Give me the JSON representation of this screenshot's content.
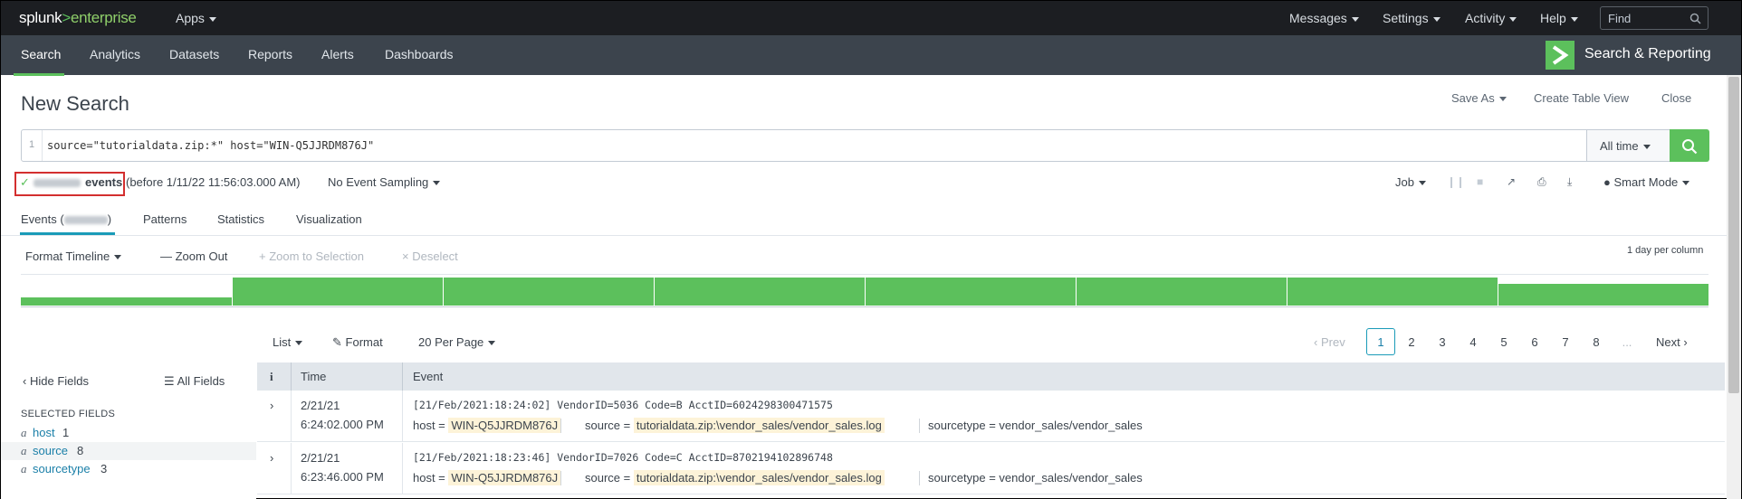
{
  "topbar": {
    "logo_splunk": "splunk",
    "logo_gt": ">",
    "logo_enterprise": "enterprise",
    "apps_label": "Apps",
    "menu": [
      "Messages",
      "Settings",
      "Activity",
      "Help"
    ],
    "find_placeholder": "Find"
  },
  "appbar": {
    "nav": [
      "Search",
      "Analytics",
      "Datasets",
      "Reports",
      "Alerts",
      "Dashboards"
    ],
    "active_nav": "Search",
    "app_title": "Search & Reporting",
    "accent_color": "#5cc05c"
  },
  "page": {
    "title": "New Search",
    "actions": {
      "save_as": "Save As",
      "create_table_view": "Create Table View",
      "close": "Close"
    }
  },
  "search": {
    "line_number": "1",
    "query": "source=\"tutorialdata.zip:*\" host=\"WIN-Q5JJRDM876J\"",
    "time_range": "All time"
  },
  "status": {
    "check": "✓",
    "events_label": "events",
    "before_text": "(before 1/11/22 11:56:03.000 AM)",
    "event_sampling": "No Event Sampling",
    "job_label": "Job",
    "mode": "Smart Mode",
    "highlight_color": "#d32f2f"
  },
  "tabs": {
    "events": "Events (",
    "events_close": ")",
    "patterns": "Patterns",
    "statistics": "Statistics",
    "visualization": "Visualization"
  },
  "timeline": {
    "format_timeline": "Format Timeline",
    "zoom_out": "— Zoom Out",
    "zoom_to_selection": "+ Zoom to Selection",
    "deselect": "× Deselect",
    "scale_note": "1 day per column",
    "column_levels": [
      0.25,
      0.9,
      0.9,
      0.9,
      0.9,
      0.9,
      0.9,
      0.7
    ]
  },
  "results_controls": {
    "list": "List",
    "format": "Format",
    "per_page": "20 Per Page",
    "prev": "Prev",
    "pages": [
      "1",
      "2",
      "3",
      "4",
      "5",
      "6",
      "7",
      "8"
    ],
    "ellipsis": "...",
    "next": "Next",
    "current_page": "1"
  },
  "sidebar": {
    "hide_fields": "Hide Fields",
    "all_fields": "All Fields",
    "selected_fields_label": "SELECTED FIELDS",
    "fields": [
      {
        "type": "a",
        "name": "host",
        "count": "1"
      },
      {
        "type": "a",
        "name": "source",
        "count": "8"
      },
      {
        "type": "a",
        "name": "sourcetype",
        "count": "3"
      }
    ]
  },
  "table": {
    "headers": {
      "info": "i",
      "time": "Time",
      "event": "Event"
    },
    "rows": [
      {
        "date": "2/21/21",
        "time": "6:24:02.000 PM",
        "raw": "[21/Feb/2021:18:24:02] VendorID=5036 Code=B AcctID=6024298300471575",
        "host_key": "host =",
        "host": "WIN-Q5JJRDM876J",
        "source_key": "source =",
        "source": "tutorialdata.zip:\\vendor_sales/vendor_sales.log",
        "sourcetype_key": "sourcetype =",
        "sourcetype": "vendor_sales/vendor_sales"
      },
      {
        "date": "2/21/21",
        "time": "6:23:46.000 PM",
        "raw": "[21/Feb/2021:18:23:46] VendorID=7026 Code=C AcctID=8702194102896748",
        "host_key": "host =",
        "host": "WIN-Q5JJRDM876J",
        "source_key": "source =",
        "source": "tutorialdata.zip:\\vendor_sales/vendor_sales.log",
        "sourcetype_key": "sourcetype =",
        "sourcetype": "vendor_sales/vendor_sales"
      }
    ]
  }
}
